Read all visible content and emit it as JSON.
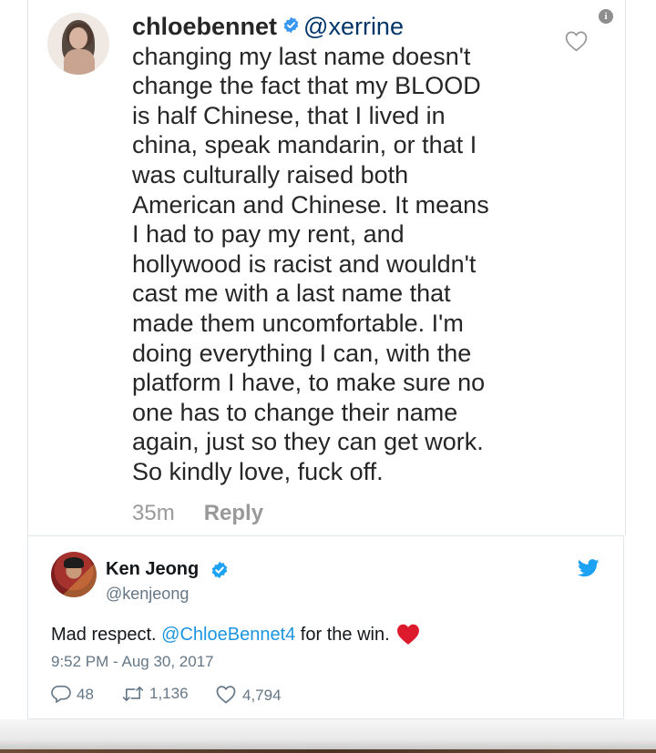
{
  "comment": {
    "username": "chloebennet",
    "mention": "@xerrine",
    "lines": [
      "changing my last name doesn't",
      "change the fact that my BLOOD",
      "is half Chinese, that I lived in",
      "china, speak mandarin, or that I",
      "was culturally raised both",
      "American and Chinese. It means",
      "I had to pay my rent, and",
      "hollywood is racist and wouldn't",
      "cast me with a last name that",
      "made them uncomfortable. I'm",
      "doing everything I can, with the",
      "platform I have, to make sure no",
      "one has to change their name",
      "again, just so they can get work.",
      "So kindly love, fuck off."
    ],
    "time": "35m",
    "reply_label": "Reply",
    "info_glyph": "i"
  },
  "tweet": {
    "name": "Ken Jeong",
    "handle": "@kenjeong",
    "text_before": "Mad respect. ",
    "mention": "@ChloeBennet4",
    "text_after": " for the win.",
    "timestamp": "9:52 PM - Aug 30, 2017",
    "replies": "48",
    "retweets": "1,136",
    "likes": "4,794"
  },
  "colors": {
    "twitter_blue": "#1da1f2",
    "ig_verified": "#3897f0",
    "heart_red": "#e0245e",
    "mention_blue": "#1b95e0"
  },
  "icons": [
    "info-icon",
    "heart-outline-icon",
    "verified-badge-icon",
    "twitter-bird-icon",
    "red-heart-emoji-icon",
    "reply-icon",
    "retweet-icon",
    "like-icon"
  ]
}
